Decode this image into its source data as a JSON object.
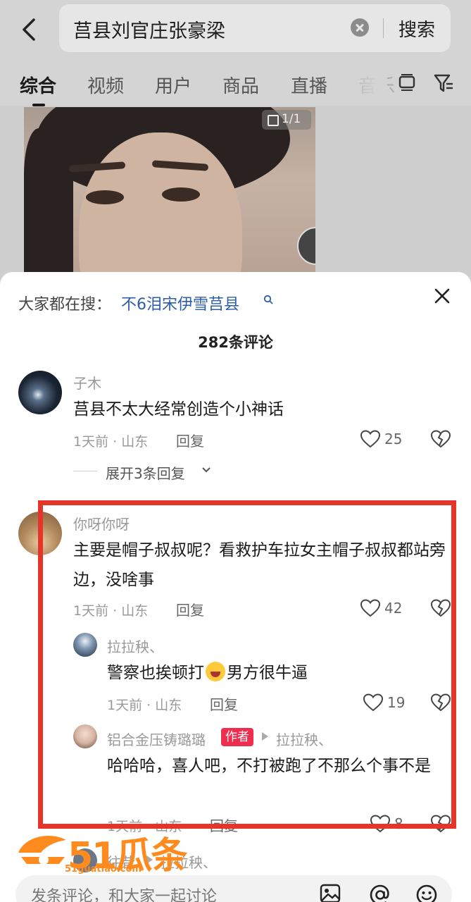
{
  "search": {
    "query": "莒县刘官庄张豪梁",
    "button_label": "搜索"
  },
  "tabs": [
    {
      "label": "综合"
    },
    {
      "label": "视频"
    },
    {
      "label": "用户"
    },
    {
      "label": "商品"
    },
    {
      "label": "直播"
    },
    {
      "label": "音乐"
    }
  ],
  "preview": {
    "page_count": "1/1"
  },
  "sheet": {
    "hot_search_prefix": "大家都在搜：",
    "hot_search_term": "不6泪宋伊雪莒县",
    "comment_count": "282条评论"
  },
  "comments": [
    {
      "user": "子木",
      "text": "莒县不太大经常创造个小神话",
      "meta": "1天前 · 山东",
      "reply_label": "回复",
      "likes": "25",
      "expand_label": "展开3条回复"
    },
    {
      "user": "你呀你呀",
      "text": "主要是帽子叔叔呢？看救护车拉女主帽子叔叔都站旁边，没啥事",
      "meta": "1天前 · 山东",
      "reply_label": "回复",
      "likes": "42",
      "replies": [
        {
          "user": "拉拉秧、",
          "text_before": "警察也挨顿打",
          "text_after": "男方很牛逼",
          "meta": "1天前 · 山东",
          "reply_label": "回复",
          "likes": "19"
        },
        {
          "user": "铝合金压铸璐璐",
          "badge": "作者",
          "reply_to": "拉拉秧、",
          "text": "哈哈哈，喜人吧，不打被跑了不那么个事不是",
          "meta": "1天前 · 山东",
          "reply_label": "回复",
          "likes": "8"
        },
        {
          "user": "往昔",
          "reply_to": "拉拉秧、"
        }
      ]
    }
  ],
  "watermark": {
    "text": "51瓜条",
    "url": "51guatiao.com"
  },
  "input": {
    "placeholder": "发条评论，和大家一起讨论"
  },
  "colors": {
    "link": "#2b5ea7",
    "author_badge": "#ee2d4f",
    "highlight": "#e5352b",
    "watermark": "#ff8a1e"
  }
}
